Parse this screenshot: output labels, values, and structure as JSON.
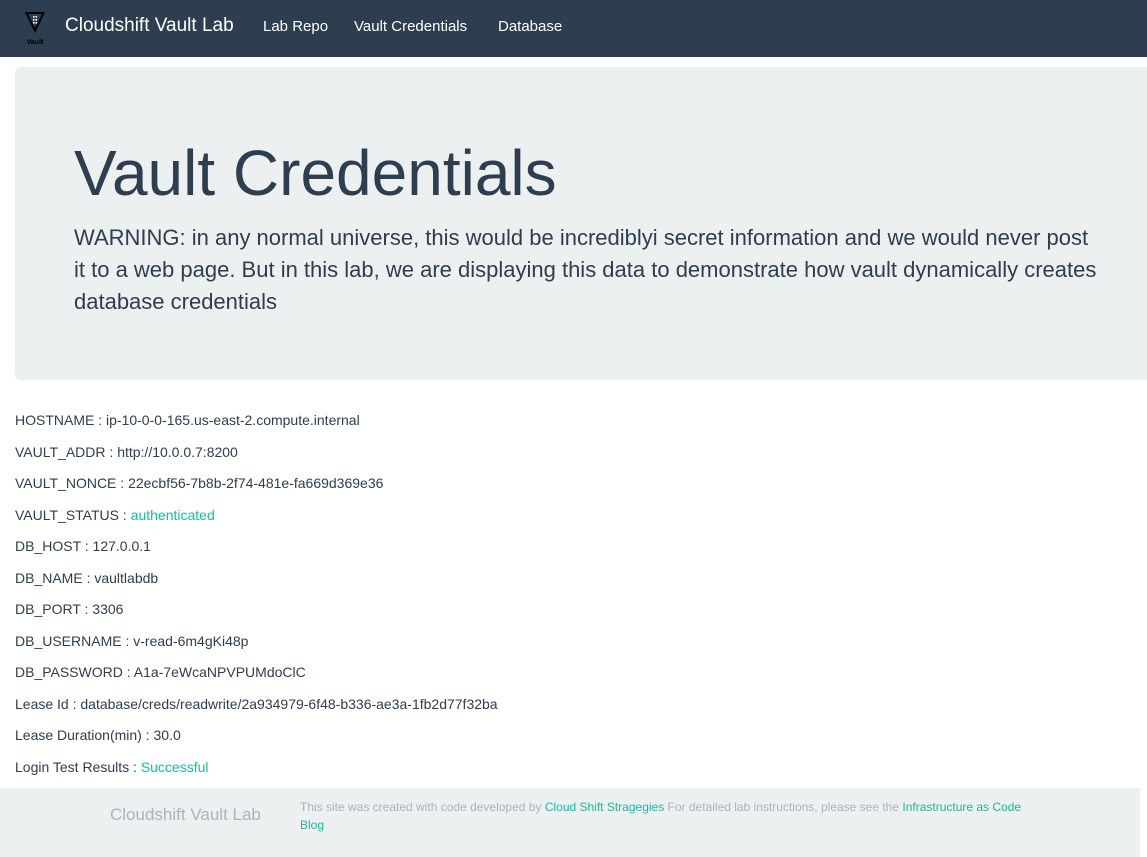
{
  "navbar": {
    "logo_icon": "vault-logo-icon",
    "logo_text": "Vault",
    "brand": "Cloudshift Vault Lab",
    "links": [
      "Lab Repo",
      "Vault Credentials",
      "Database"
    ]
  },
  "jumbotron": {
    "title": "Vault Credentials",
    "text": "WARNING: in any normal universe, this would be incrediblyi secret information and we would never post it to a web page. But in this lab, we are displaying this data to demonstrate how vault dynamically creates database credentials"
  },
  "details": [
    {
      "label": "HOSTNAME",
      "value": "ip-10-0-0-165.us-east-2.compute.internal"
    },
    {
      "label": "VAULT_ADDR",
      "value": "http://10.0.0.7:8200"
    },
    {
      "label": "VAULT_NONCE",
      "value": "22ecbf56-7b8b-2f74-481e-fa669d369e36"
    },
    {
      "label": "VAULT_STATUS",
      "value": "authenticated"
    },
    {
      "label": "DB_HOST",
      "value": "127.0.0.1"
    },
    {
      "label": "DB_NAME",
      "value": "vaultlabdb"
    },
    {
      "label": "DB_PORT",
      "value": "3306"
    },
    {
      "label": "DB_USERNAME",
      "value": "v-read-6m4gKi48p"
    },
    {
      "label": "DB_PASSWORD",
      "value": "A1a-7eWcaNPVPUMdoClC"
    },
    {
      "label": "Lease Id",
      "value": "database/creds/readwrite/2a934979-6f48-b336-ae3a-1fb2d77f32ba"
    },
    {
      "label": "Lease Duration(min)",
      "value": "30.0"
    },
    {
      "label": "Login Test Results",
      "value": "Successful"
    }
  ],
  "separator": " : ",
  "footer": {
    "brand": "Cloudshift Vault Lab",
    "text_1": "This site was created with code developed by ",
    "link_1": "Cloud Shift Stragegies",
    "text_2": " For detailed lab instructions, please see the ",
    "link_2": "Infrastructure as Code Blog"
  },
  "colors": {
    "navbar_bg": "#2c3e50",
    "jumbotron_bg": "#ecf0f1",
    "accent": "#18bc9c",
    "text": "#2c3e50",
    "muted": "#a9b4bb"
  }
}
